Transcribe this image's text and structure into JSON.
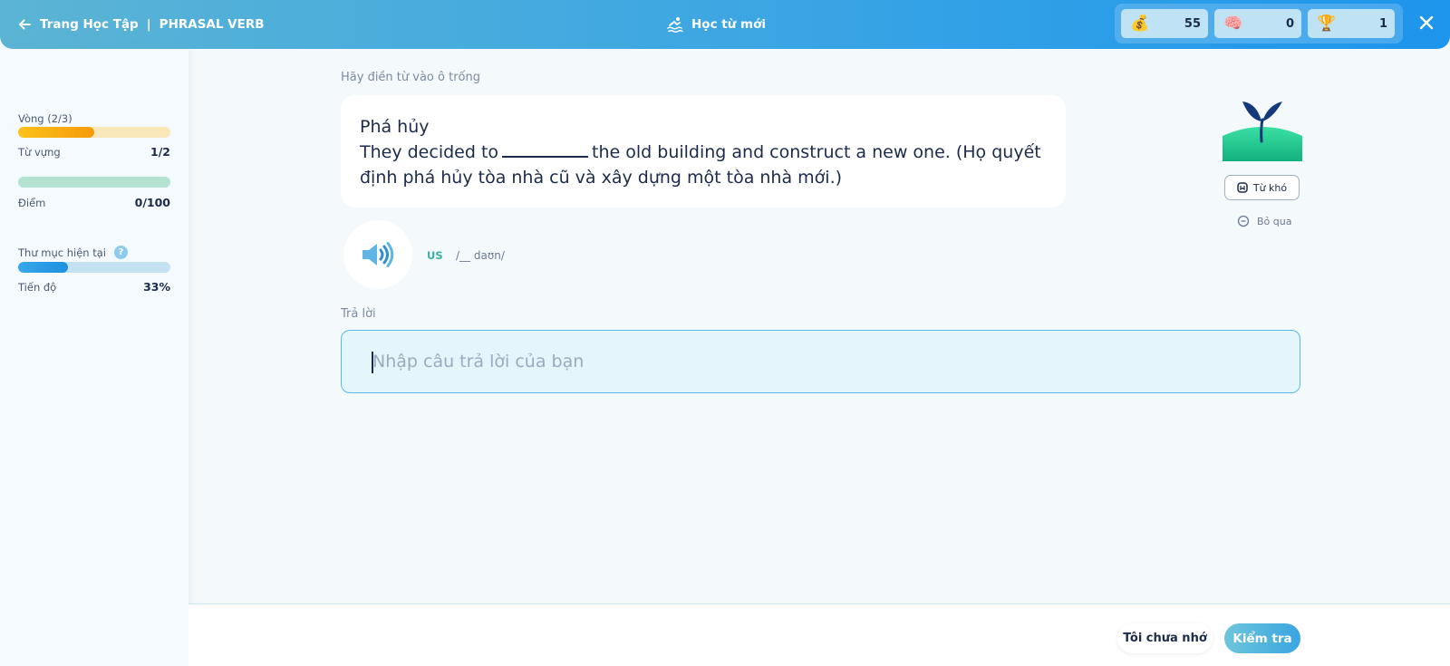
{
  "header": {
    "back_label": "Trang Học Tập",
    "separator": "|",
    "section": "PHRASAL VERB",
    "title": "Học từ mới",
    "stats": [
      {
        "icon": "money-bag-icon",
        "glyph": "💰",
        "value": "55"
      },
      {
        "icon": "brain-icon",
        "glyph": "🧠",
        "value": "0"
      },
      {
        "icon": "trophy-icon",
        "glyph": "🏆",
        "value": "1"
      }
    ]
  },
  "sidebar": {
    "round_label": "Vòng (2/3)",
    "round_progress": 0.5,
    "vocab_label": "Từ vựng",
    "vocab_value": "1/2",
    "score_label": "Điểm",
    "score_value": "0/100",
    "score_progress": 0,
    "folder_label": "Thư mục hiện tại",
    "folder_help": "?",
    "folder_progress": 0.33,
    "progress_label": "Tiến độ",
    "progress_value": "33%"
  },
  "main": {
    "instruction": "Hãy điền từ vào ô trống",
    "word_meaning": "Phá hủy",
    "sentence_before": "They decided to",
    "sentence_after": "the old building and construct a new one. (Họ quyết định phá hủy tòa nhà cũ và xây dựng một tòa nhà mới.)",
    "accent": "US",
    "phonetic": "/__ daʊn/",
    "answer_label": "Trả lời",
    "answer_placeholder": "Nhập câu trả lời của bạn",
    "answer_value": "",
    "hard_word_label": "Từ khó",
    "skip_label": "Bỏ qua"
  },
  "footer": {
    "not_remember_label": "Tôi chưa nhớ",
    "check_label": "Kiểm tra"
  },
  "colors": {
    "header_start": "#5bb4d4",
    "header_end": "#1d95ec",
    "round_bar_fill": "#f5a50f",
    "round_bar_track": "#f8e7b8",
    "score_bar_track": "#b5e3d1",
    "folder_bar_fill": "#1f8fe0",
    "folder_bar_track": "#c5e2f2",
    "accent_green": "#3ab0a0"
  }
}
